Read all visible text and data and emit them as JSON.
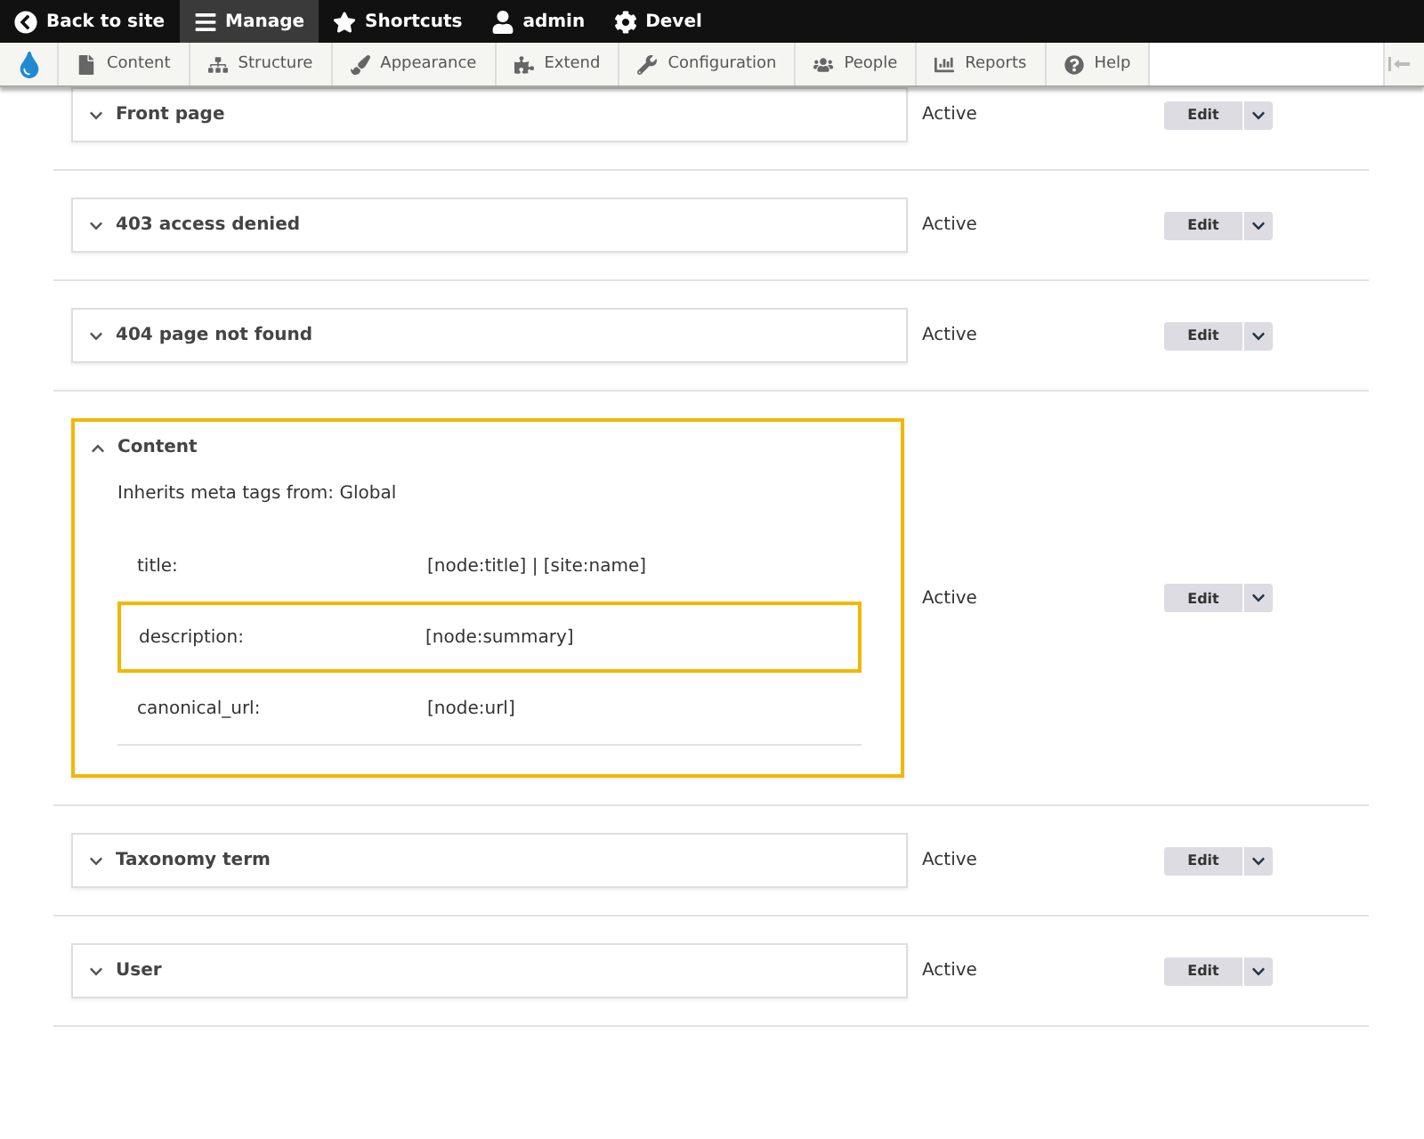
{
  "toolbar": {
    "items": [
      {
        "label": "Back to site",
        "selected": false
      },
      {
        "label": "Manage",
        "selected": true
      },
      {
        "label": "Shortcuts",
        "selected": false
      },
      {
        "label": "admin",
        "selected": false
      },
      {
        "label": "Devel",
        "selected": false
      }
    ]
  },
  "tray": {
    "items": [
      {
        "label": "Content"
      },
      {
        "label": "Structure"
      },
      {
        "label": "Appearance"
      },
      {
        "label": "Extend"
      },
      {
        "label": "Configuration"
      },
      {
        "label": "People"
      },
      {
        "label": "Reports"
      },
      {
        "label": "Help"
      }
    ]
  },
  "rows": [
    {
      "label": "Front page",
      "expanded": false,
      "highlighted": false,
      "status": "Active",
      "edit": "Edit"
    },
    {
      "label": "403 access denied",
      "expanded": false,
      "highlighted": false,
      "status": "Active",
      "edit": "Edit"
    },
    {
      "label": "404 page not found",
      "expanded": false,
      "highlighted": false,
      "status": "Active",
      "edit": "Edit"
    },
    {
      "label": "Content",
      "expanded": true,
      "highlighted": true,
      "status": "Active",
      "edit": "Edit",
      "inherits": "Inherits meta tags from: Global",
      "tags": [
        {
          "name": "title:",
          "value": "[node:title] | [site:name]",
          "highlighted": false
        },
        {
          "name": "description:",
          "value": "[node:summary]",
          "highlighted": true
        },
        {
          "name": "canonical_url:",
          "value": "[node:url]",
          "highlighted": false
        }
      ]
    },
    {
      "label": "Taxonomy term",
      "expanded": false,
      "highlighted": false,
      "status": "Active",
      "edit": "Edit"
    },
    {
      "label": "User",
      "expanded": false,
      "highlighted": false,
      "status": "Active",
      "edit": "Edit"
    }
  ]
}
